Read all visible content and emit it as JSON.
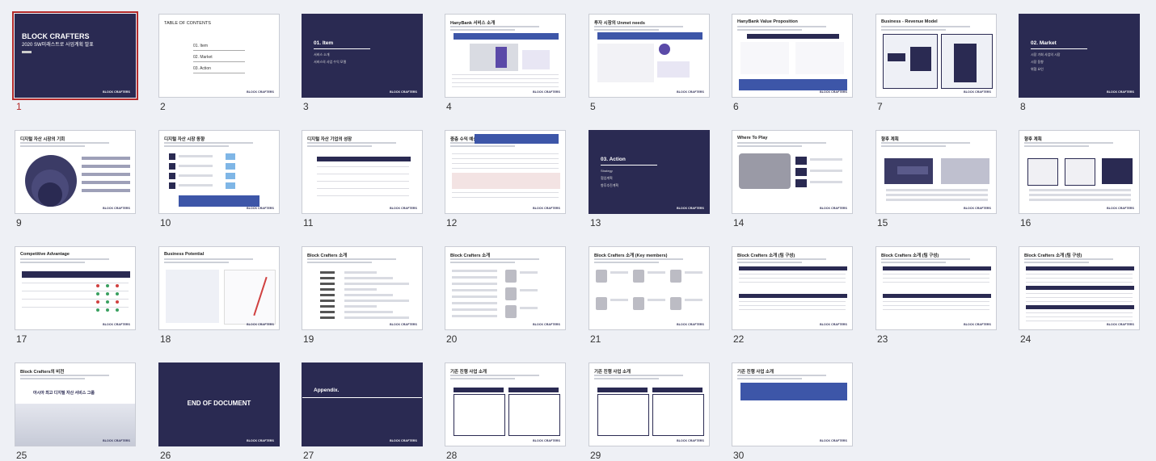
{
  "slides": [
    {
      "n": "1",
      "kind": "title",
      "title": "BLOCK CRAFTERS",
      "sub": "2020 SW미래스트로 사업계획 발표",
      "selected": true
    },
    {
      "n": "2",
      "kind": "toc",
      "title": "TABLE OF CONTENTS",
      "items": [
        "01. Item",
        "02. Market",
        "03. Action"
      ]
    },
    {
      "n": "3",
      "kind": "section",
      "title": "01. Item",
      "items": [
        "서비스 소개",
        "서비스의 사업 수익 모델"
      ]
    },
    {
      "n": "4",
      "kind": "content",
      "title": "HanyBank 서비스 소개",
      "variant": "devices"
    },
    {
      "n": "5",
      "kind": "content",
      "title": "투자 시장의 Unmet needs",
      "variant": "needs"
    },
    {
      "n": "6",
      "kind": "content",
      "title": "HanyBank Value Proposition",
      "variant": "chart"
    },
    {
      "n": "7",
      "kind": "content",
      "title": "Business - Revenue Model",
      "variant": "revenue"
    },
    {
      "n": "8",
      "kind": "section",
      "title": "02. Market",
      "items": [
        "시장 기회 사업의 시장",
        "시장 동향",
        "위협 요인"
      ]
    },
    {
      "n": "9",
      "kind": "content",
      "title": "디지털 자산 시장의 기회",
      "variant": "circles"
    },
    {
      "n": "10",
      "kind": "content",
      "title": "디지털 자산 시장 동향",
      "variant": "icons"
    },
    {
      "n": "11",
      "kind": "content",
      "title": "디지털 자산 기업의 성장",
      "variant": "table"
    },
    {
      "n": "12",
      "kind": "content",
      "title": "중층 수익 예상",
      "variant": "pnl"
    },
    {
      "n": "13",
      "kind": "section",
      "title": "03. Action",
      "items": [
        "Strategy",
        "협업계획",
        "향후추진계획"
      ]
    },
    {
      "n": "14",
      "kind": "content",
      "title": "Where To Play",
      "variant": "map"
    },
    {
      "n": "15",
      "kind": "content",
      "title": "향후 계획",
      "variant": "plan"
    },
    {
      "n": "16",
      "kind": "content",
      "title": "향후 계획",
      "variant": "plan2"
    },
    {
      "n": "17",
      "kind": "content",
      "title": "Competitive Advantage",
      "variant": "compare"
    },
    {
      "n": "18",
      "kind": "content",
      "title": "Business Potential",
      "variant": "growth"
    },
    {
      "n": "19",
      "kind": "content",
      "title": "Block Crafters 소개",
      "variant": "list"
    },
    {
      "n": "20",
      "kind": "content",
      "title": "Block Crafters 소개",
      "variant": "people2"
    },
    {
      "n": "21",
      "kind": "content",
      "title": "Block Crafters 소개 (Key members)",
      "variant": "people"
    },
    {
      "n": "22",
      "kind": "content",
      "title": "Block Crafters 소개 (팀 구성)",
      "variant": "team"
    },
    {
      "n": "23",
      "kind": "content",
      "title": "Block Crafters 소개 (팀 구성)",
      "variant": "team2"
    },
    {
      "n": "24",
      "kind": "content",
      "title": "Block Crafters 소개 (팀 구성)",
      "variant": "team3"
    },
    {
      "n": "25",
      "kind": "content",
      "title": "Block Crafters의 비전",
      "variant": "vision"
    },
    {
      "n": "26",
      "kind": "end",
      "title": "END OF DOCUMENT"
    },
    {
      "n": "27",
      "kind": "appendix",
      "title": "Appendix."
    },
    {
      "n": "28",
      "kind": "content",
      "title": "기존 진행 사업 소개",
      "variant": "exist"
    },
    {
      "n": "29",
      "kind": "content",
      "title": "기존 진행 사업 소개",
      "variant": "exist2"
    },
    {
      "n": "30",
      "kind": "content",
      "title": "기존 진행 사업 소개",
      "variant": "exist3"
    }
  ],
  "logo_text": "BLOCK CRAFTERS",
  "slide25_text": "아시아 최고 디지털 자산 서비스 그룹",
  "colors": {
    "navy": "#2a2a52",
    "blue": "#3d56a8",
    "selection": "#b42a2a"
  }
}
